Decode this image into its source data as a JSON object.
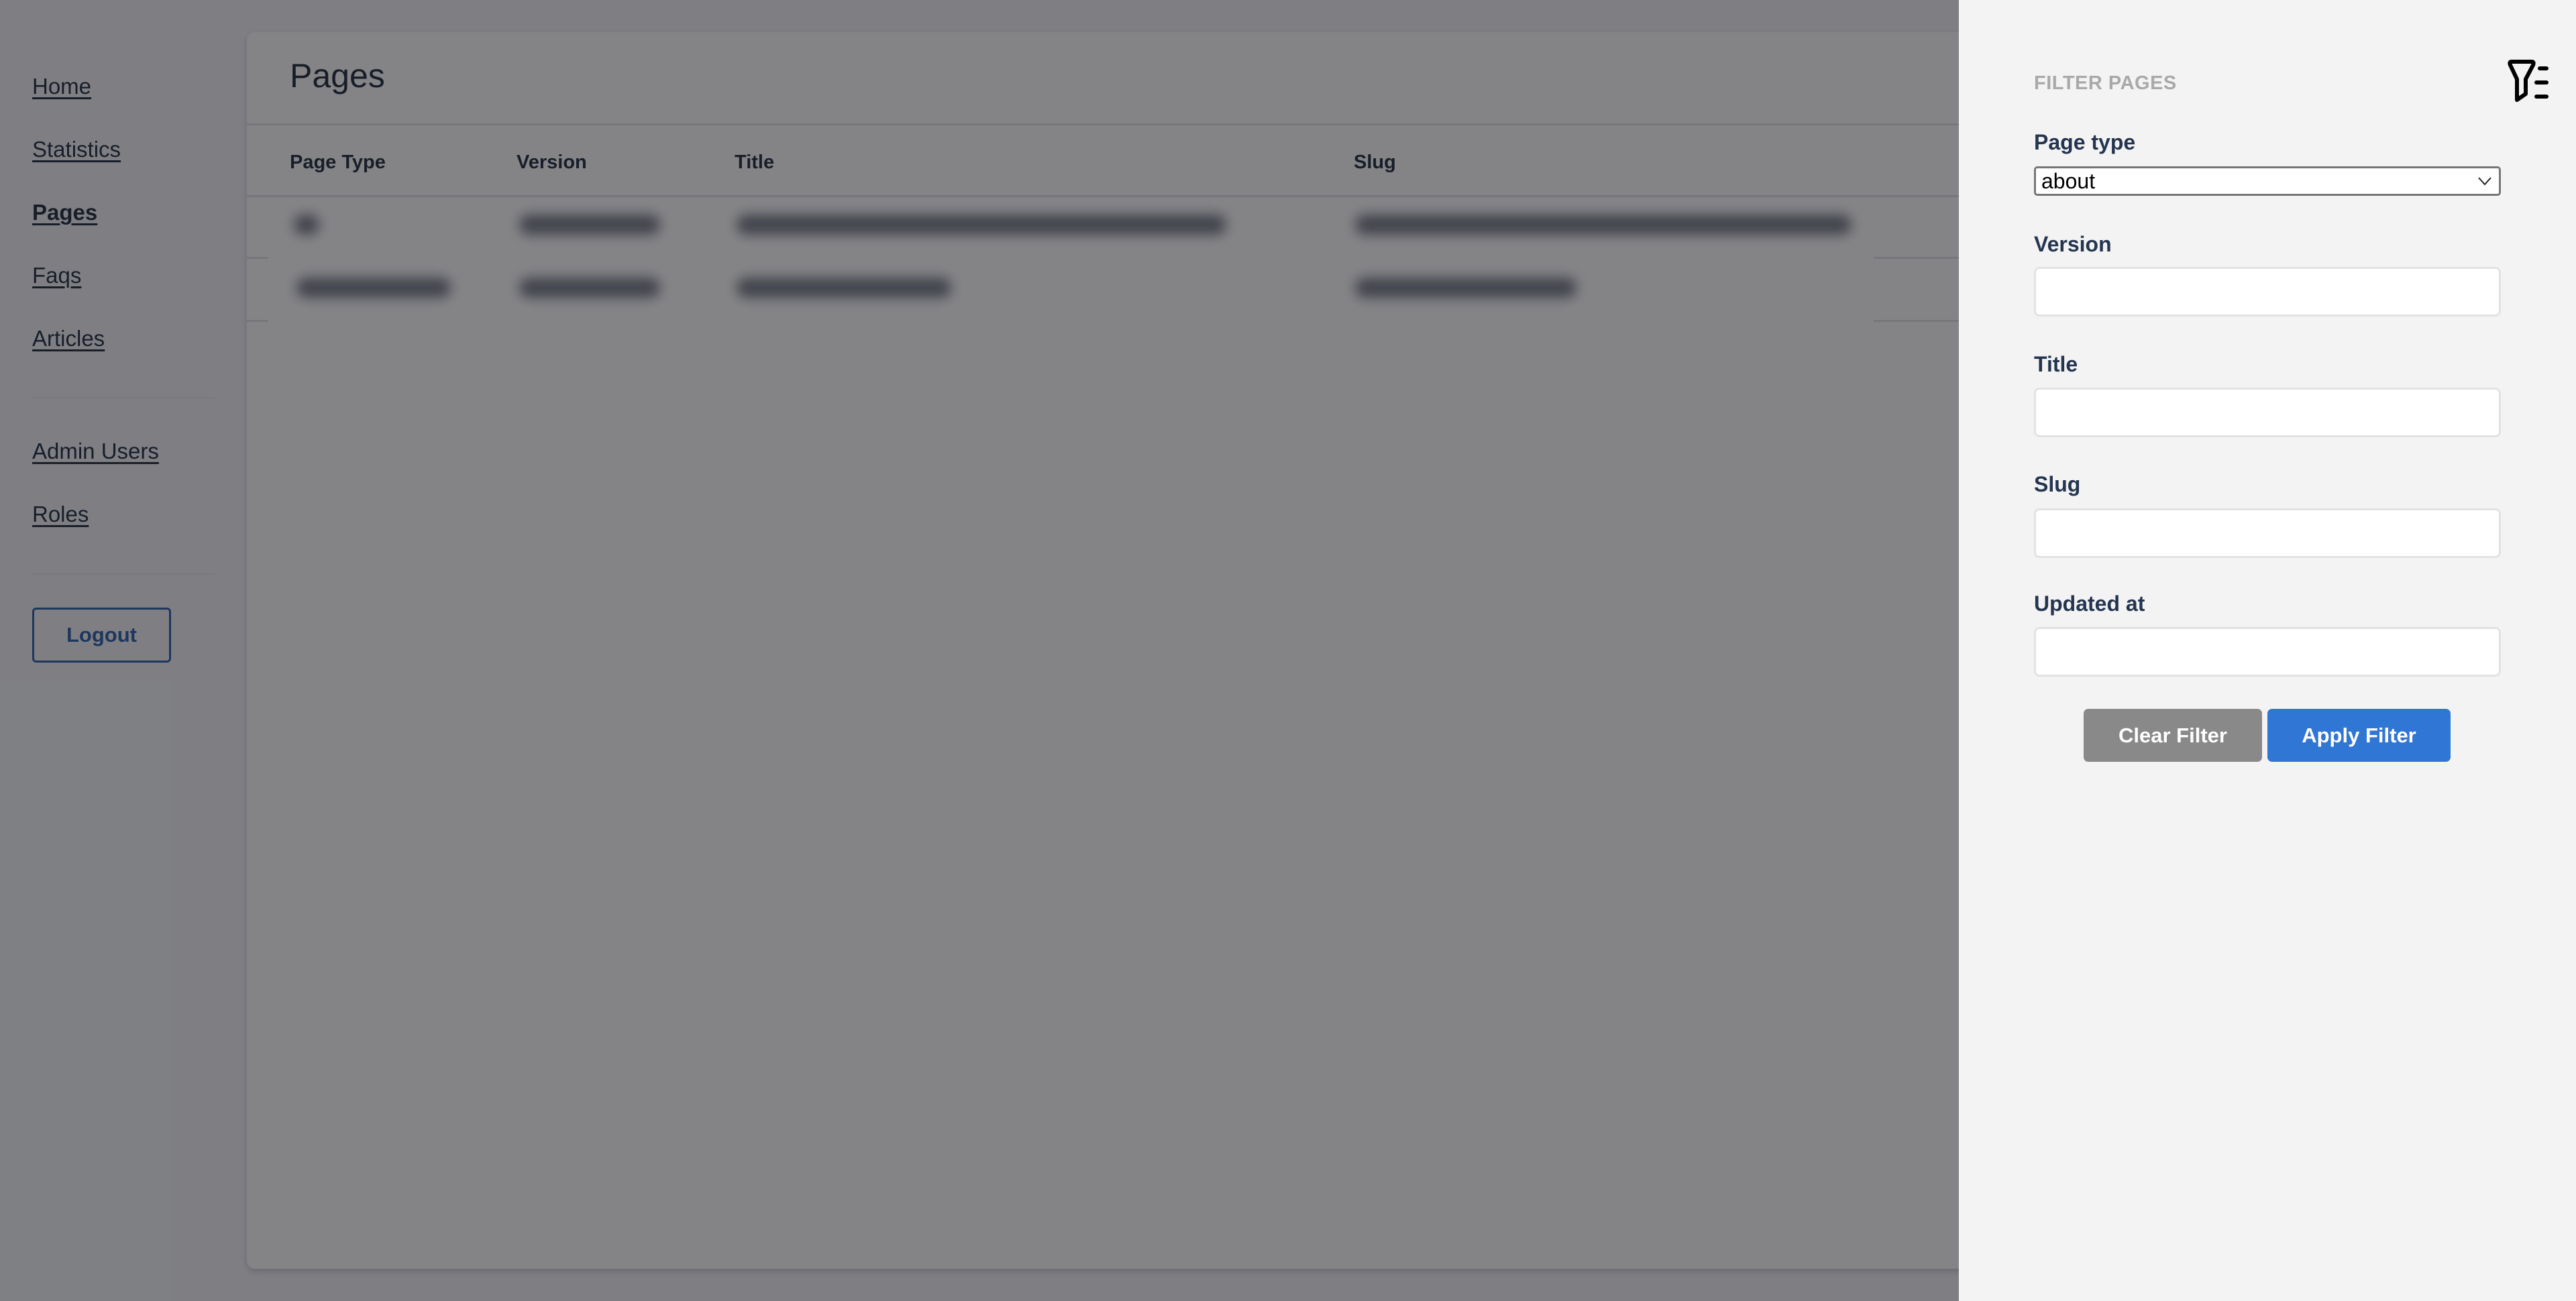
{
  "sidebar": {
    "primary_items": [
      {
        "label": "Home",
        "active": false
      },
      {
        "label": "Statistics",
        "active": false
      },
      {
        "label": "Pages",
        "active": true
      },
      {
        "label": "Faqs",
        "active": false
      },
      {
        "label": "Articles",
        "active": false
      }
    ],
    "secondary_items": [
      {
        "label": "Admin Users",
        "active": false
      },
      {
        "label": "Roles",
        "active": false
      }
    ],
    "logout_label": "Logout"
  },
  "main": {
    "title": "Pages",
    "table": {
      "columns": [
        "Page Type",
        "Version",
        "Title",
        "Slug"
      ],
      "rows_obscured": true,
      "row_count": 2
    }
  },
  "filter_panel": {
    "title": "FILTER PAGES",
    "icon": "filter-list-icon",
    "fields": {
      "page_type": {
        "label": "Page type",
        "value": "about"
      },
      "version": {
        "label": "Version",
        "value": ""
      },
      "title": {
        "label": "Title",
        "value": ""
      },
      "slug": {
        "label": "Slug",
        "value": ""
      },
      "updated_at": {
        "label": "Updated at",
        "value": ""
      }
    },
    "clear_label": "Clear Filter",
    "apply_label": "Apply Filter"
  },
  "colors": {
    "accent": "#3076d5",
    "clear_button": "#898989",
    "drawer_bg": "#f3f3f3",
    "label_text": "#253550",
    "logout_border": "#2a5ea8"
  }
}
